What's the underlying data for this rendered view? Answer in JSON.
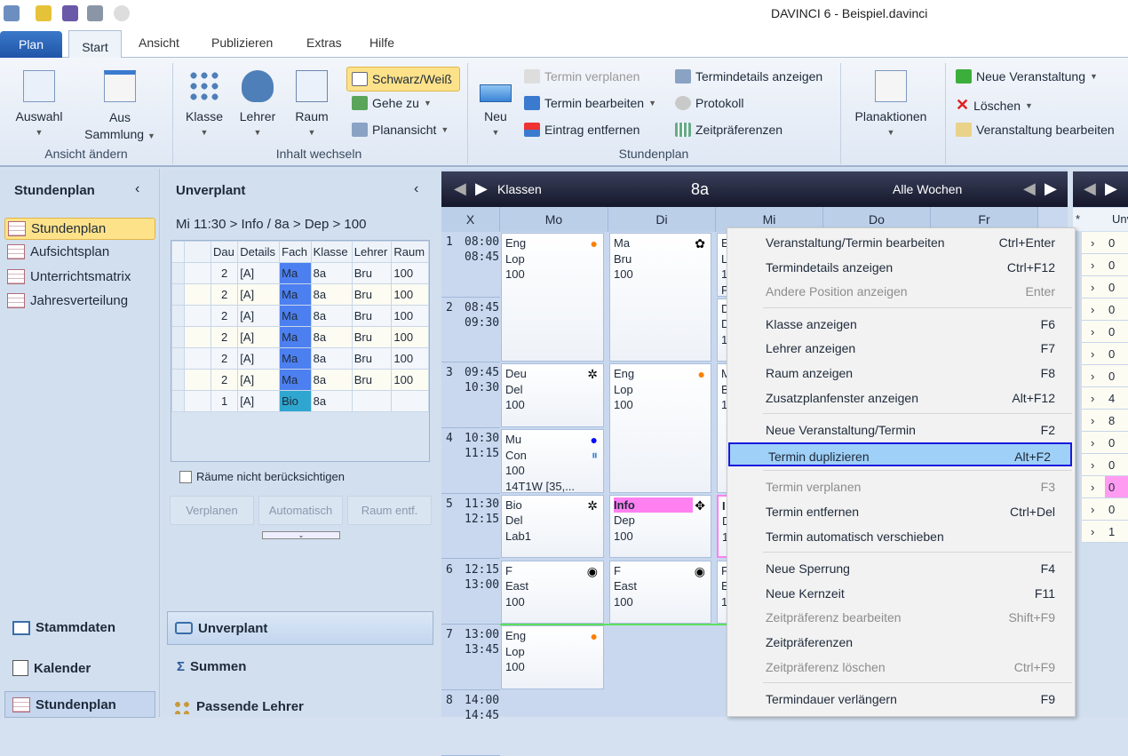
{
  "window": {
    "title": "DAVINCI 6 - Beispiel.davinci"
  },
  "tabs": {
    "plan": "Plan",
    "items": [
      "Start",
      "Ansicht",
      "Publizieren",
      "Extras",
      "Hilfe"
    ]
  },
  "ribbon": {
    "groups": [
      "Ansicht ändern",
      "Inhalt wechseln",
      "Stundenplan"
    ],
    "auswahl": "Auswahl",
    "aus_sammlung_1": "Aus",
    "aus_sammlung_2": "Sammlung",
    "klasse": "Klasse",
    "lehrer": "Lehrer",
    "raum": "Raum",
    "schwarzweiss": "Schwarz/Weiß",
    "gehe_zu": "Gehe zu",
    "planansicht": "Planansicht",
    "neu": "Neu",
    "termin_verplanen": "Termin verplanen",
    "termin_bearbeiten": "Termin bearbeiten",
    "eintrag_entfernen": "Eintrag entfernen",
    "termindetails": "Termindetails anzeigen",
    "protokoll": "Protokoll",
    "zeitpraeferenzen": "Zeitpräferenzen",
    "planaktionen": "Planaktionen",
    "neue_veranstaltung": "Neue Veranstaltung",
    "loeschen": "Löschen",
    "veranstaltung_bearbeiten": "Veranstaltung bearbeiten"
  },
  "sidebar": {
    "title": "Stundenplan",
    "items": [
      "Stundenplan",
      "Aufsichtsplan",
      "Unterrichtsmatrix",
      "Jahresverteilung"
    ],
    "bottom": [
      "Stammdaten",
      "Kalender",
      "Stundenplan"
    ]
  },
  "unverplant": {
    "title": "Unverplant",
    "breadcrumb": "Mi 11:30 > Info / 8a > Dep > 100",
    "columns": [
      "Dau",
      "Details",
      "Fach",
      "Klasse",
      "Lehrer",
      "Raum"
    ],
    "rows": [
      [
        "2",
        "[A]",
        "Ma",
        "8a",
        "Bru",
        "100"
      ],
      [
        "2",
        "[A]",
        "Ma",
        "8a",
        "Bru",
        "100"
      ],
      [
        "2",
        "[A]",
        "Ma",
        "8a",
        "Bru",
        "100"
      ],
      [
        "2",
        "[A]",
        "Ma",
        "8a",
        "Bru",
        "100"
      ],
      [
        "2",
        "[A]",
        "Ma",
        "8a",
        "Bru",
        "100"
      ],
      [
        "2",
        "[A]",
        "Ma",
        "8a",
        "Bru",
        "100"
      ],
      [
        "1",
        "[A]",
        "Bio",
        "8a",
        "",
        ""
      ]
    ],
    "checkbox": "Räume nicht berücksichtigen",
    "checked": false,
    "buttons": [
      "Verplanen",
      "Automatisch",
      "Raum entf."
    ],
    "bottom": [
      "Unverplant",
      "Summen",
      "Passende Lehrer"
    ]
  },
  "schedule": {
    "mode": "Klassen",
    "class": "8a",
    "weeks": "Alle Wochen",
    "columns": [
      "X",
      "Mo",
      "Di",
      "Mi",
      "Do",
      "Fr"
    ],
    "periods": [
      [
        "1",
        "08:00",
        "08:45"
      ],
      [
        "2",
        "08:45",
        "09:30"
      ],
      [
        "3",
        "09:45",
        "10:30"
      ],
      [
        "4",
        "10:30",
        "11:15"
      ],
      [
        "5",
        "11:30",
        "12:15"
      ],
      [
        "6",
        "12:15",
        "13:00"
      ],
      [
        "7",
        "13:00",
        "13:45"
      ],
      [
        "8",
        "14:00",
        "14:45"
      ]
    ],
    "lessons": [
      {
        "day": 0,
        "p": 0,
        "len": 2,
        "lines": [
          "Eng",
          "Lop",
          "100"
        ],
        "icon": "apple-icon",
        "color": "#ff7f00"
      },
      {
        "day": 0,
        "p": 2,
        "len": 1,
        "lines": [
          "Deu",
          "Del",
          "100"
        ],
        "icon": "pattern-icon",
        "color": "#000"
      },
      {
        "day": 0,
        "p": 3,
        "len": 1,
        "lines": [
          "Mu",
          "Con",
          "100",
          "14T1W [35,..."
        ],
        "icon": "apple-icon",
        "color": "#0a0aff"
      },
      {
        "day": 0,
        "p": 4,
        "len": 1,
        "lines": [
          "Bio",
          "Del",
          "Lab1"
        ],
        "icon": "pattern-icon",
        "color": "#000"
      },
      {
        "day": 0,
        "p": 5,
        "len": 1,
        "lines": [
          "F",
          "East",
          "100"
        ],
        "icon": "ring-icon",
        "color": "#000"
      },
      {
        "day": 0,
        "p": 6,
        "len": 1,
        "lines": [
          "Eng",
          "Lop",
          "100"
        ],
        "icon": "apple-icon",
        "color": "#ff7f00"
      },
      {
        "day": 1,
        "p": 0,
        "len": 2,
        "lines": [
          "Ma",
          "Bru",
          "100"
        ],
        "icon": "flower-icon",
        "color": "#000"
      },
      {
        "day": 1,
        "p": 2,
        "len": 2,
        "lines": [
          "Eng",
          "Lop",
          "100"
        ],
        "icon": "apple-icon",
        "color": "#ff7f00"
      },
      {
        "day": 1,
        "p": 4,
        "len": 1,
        "lines": [
          "Info",
          "Dep",
          "100"
        ],
        "icon": "move-icon",
        "color": "#000",
        "highlight": "#ff80f0"
      },
      {
        "day": 1,
        "p": 5,
        "len": 1,
        "lines": [
          "F",
          "East",
          "100"
        ],
        "icon": "ring-icon",
        "color": "#000"
      },
      {
        "day": 2,
        "p": 0,
        "len": 1,
        "lines": [
          "E",
          "L",
          "1",
          "P"
        ]
      },
      {
        "day": 2,
        "p": 1,
        "len": 1,
        "lines": [
          "D",
          "D",
          "1"
        ]
      },
      {
        "day": 2,
        "p": 2,
        "len": 2,
        "lines": [
          "M",
          "B",
          "1"
        ]
      },
      {
        "day": 2,
        "p": 4,
        "len": 1,
        "lines": [
          "I",
          "D",
          "1"
        ],
        "highlight": "#ff80f0"
      },
      {
        "day": 2,
        "p": 5,
        "len": 1,
        "lines": [
          "F",
          "E",
          "1"
        ]
      }
    ]
  },
  "context_menu": [
    {
      "label": "Veranstaltung/Termin bearbeiten",
      "shortcut": "Ctrl+Enter"
    },
    {
      "label": "Termindetails anzeigen",
      "shortcut": "Ctrl+F12"
    },
    {
      "label": "Andere Position anzeigen",
      "shortcut": "Enter",
      "disabled": true
    },
    {
      "sep": true
    },
    {
      "label": "Klasse anzeigen",
      "shortcut": "F6"
    },
    {
      "label": "Lehrer anzeigen",
      "shortcut": "F7"
    },
    {
      "label": "Raum anzeigen",
      "shortcut": "F8"
    },
    {
      "label": "Zusatzplanfenster anzeigen",
      "shortcut": "Alt+F12"
    },
    {
      "sep": true
    },
    {
      "label": "Neue Veranstaltung/Termin",
      "shortcut": "F2"
    },
    {
      "label": "Termin duplizieren",
      "shortcut": "Alt+F2",
      "highlighted": true
    },
    {
      "sep": true
    },
    {
      "label": "Termin verplanen",
      "shortcut": "F3",
      "disabled": true
    },
    {
      "label": "Termin entfernen",
      "shortcut": "Ctrl+Del"
    },
    {
      "label": "Termin automatisch verschieben",
      "shortcut": ""
    },
    {
      "sep": true
    },
    {
      "label": "Neue Sperrung",
      "shortcut": "F4"
    },
    {
      "label": "Neue Kernzeit",
      "shortcut": "F11"
    },
    {
      "label": "Zeitpräferenz bearbeiten",
      "shortcut": "Shift+F9",
      "disabled": true
    },
    {
      "label": "Zeitpräferenzen",
      "shortcut": ""
    },
    {
      "label": "Zeitpräferenz löschen",
      "shortcut": "Ctrl+F9",
      "disabled": true
    },
    {
      "sep": true
    },
    {
      "label": "Termindauer verlängern",
      "shortcut": "F9"
    }
  ],
  "right_panel": {
    "header": "Unv",
    "values": [
      "0",
      "0",
      "0",
      "0",
      "0",
      "0",
      "0",
      "4",
      "8",
      "0",
      "0",
      "0",
      "0",
      "1"
    ],
    "highlight_index": 11
  }
}
